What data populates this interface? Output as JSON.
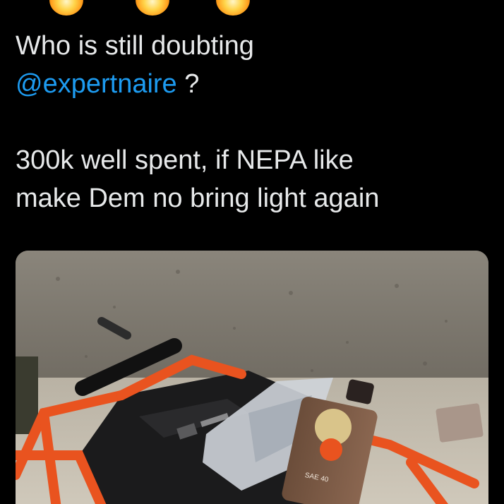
{
  "tweet": {
    "line1": "Who is still doubting",
    "mention": "@expertnaire",
    "mention_suffix": " ?",
    "line3": "300k well spent, if NEPA like",
    "line4": "make Dem no bring light again"
  },
  "icons": {
    "top_emojis": [
      "fire-emoji-icon",
      "fire-emoji-icon",
      "fire-emoji-icon"
    ]
  },
  "media": {
    "oil_bottle_label": "SAE 40"
  },
  "colors": {
    "background": "#000000",
    "text": "#e7e9ea",
    "mention": "#1d9bf0",
    "generator_frame": "#e9531f"
  }
}
